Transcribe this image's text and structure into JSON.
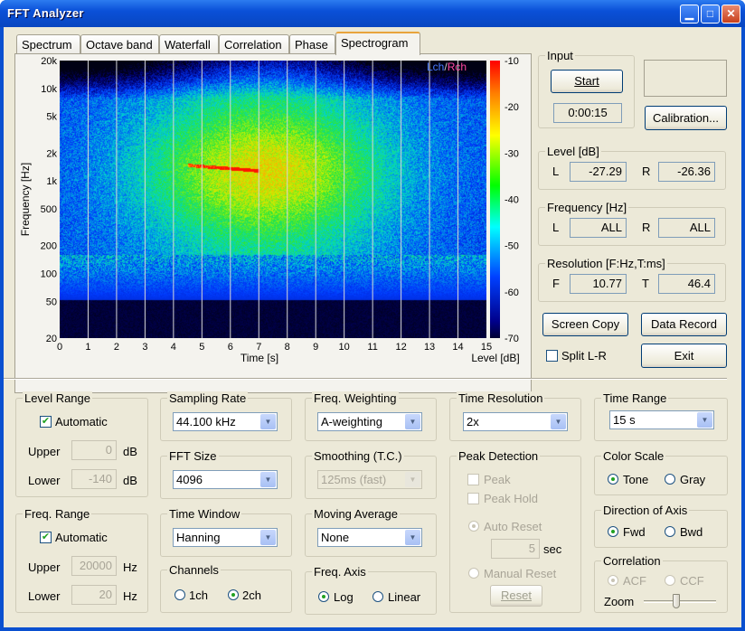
{
  "window": {
    "title": "FFT Analyzer"
  },
  "tabs": [
    "Spectrum",
    "Octave band",
    "Waterfall",
    "Correlation",
    "Phase",
    "Spectrogram"
  ],
  "chart_data": {
    "type": "heatmap",
    "title": "",
    "xlabel": "Time [s]",
    "ylabel": "Frequency [Hz]",
    "x_ticks": [
      "0",
      "1",
      "2",
      "3",
      "4",
      "5",
      "6",
      "7",
      "8",
      "9",
      "10",
      "11",
      "12",
      "13",
      "14",
      "15"
    ],
    "y_ticks": [
      "20k",
      "10k",
      "5k",
      "2k",
      "1k",
      "500",
      "200",
      "100",
      "50",
      "20"
    ],
    "xlim": [
      0,
      15
    ],
    "ylim": [
      20,
      20000
    ],
    "y_scale": "log",
    "colorbar_ticks": [
      "-10",
      "-20",
      "-30",
      "-40",
      "-50",
      "-60",
      "-70"
    ],
    "colorbar_label": "Level [dB]",
    "legend": [
      "Lch",
      "Rch"
    ],
    "legend_sep": "/"
  },
  "input": {
    "group": "Input",
    "start": "Start",
    "time": "0:00:15",
    "calibration": "Calibration..."
  },
  "level": {
    "group": "Level [dB]",
    "l_label": "L",
    "l_value": "-27.29",
    "r_label": "R",
    "r_value": "-26.36"
  },
  "frequency": {
    "group": "Frequency [Hz]",
    "l_label": "L",
    "l_value": "ALL",
    "r_label": "R",
    "r_value": "ALL"
  },
  "resolution": {
    "group": "Resolution [F:Hz,T:ms]",
    "f_label": "F",
    "f_value": "10.77",
    "t_label": "T",
    "t_value": "46.4"
  },
  "actions": {
    "screen_copy": "Screen Copy",
    "data_record": "Data Record",
    "split": "Split L-R",
    "exit": "Exit"
  },
  "level_range": {
    "group": "Level Range",
    "automatic": "Automatic",
    "upper_label": "Upper",
    "upper_value": "0",
    "lower_label": "Lower",
    "lower_value": "-140",
    "unit": "dB"
  },
  "freq_range": {
    "group": "Freq. Range",
    "automatic": "Automatic",
    "upper_label": "Upper",
    "upper_value": "20000",
    "lower_label": "Lower",
    "lower_value": "20",
    "unit": "Hz"
  },
  "sampling_rate": {
    "group": "Sampling Rate",
    "value": "44.100 kHz"
  },
  "fft_size": {
    "group": "FFT Size",
    "value": "4096"
  },
  "time_window": {
    "group": "Time Window",
    "value": "Hanning"
  },
  "channels": {
    "group": "Channels",
    "opt1": "1ch",
    "opt2": "2ch"
  },
  "freq_weighting": {
    "group": "Freq. Weighting",
    "value": "A-weighting"
  },
  "smoothing": {
    "group": "Smoothing (T.C.)",
    "value": "125ms (fast)"
  },
  "moving_average": {
    "group": "Moving Average",
    "value": "None"
  },
  "freq_axis": {
    "group": "Freq. Axis",
    "opt1": "Log",
    "opt2": "Linear"
  },
  "time_resolution": {
    "group": "Time Resolution",
    "value": "2x"
  },
  "peak_detection": {
    "group": "Peak Detection",
    "peak": "Peak",
    "peak_hold": "Peak Hold",
    "auto_reset": "Auto Reset",
    "seconds": "5",
    "sec": "sec",
    "manual_reset": "Manual Reset",
    "reset": "Reset"
  },
  "time_range": {
    "group": "Time Range",
    "value": "15 s"
  },
  "color_scale": {
    "group": "Color Scale",
    "opt1": "Tone",
    "opt2": "Gray"
  },
  "direction": {
    "group": "Direction of Axis",
    "opt1": "Fwd",
    "opt2": "Bwd"
  },
  "correlation": {
    "group": "Correlation",
    "opt1": "ACF",
    "opt2": "CCF",
    "zoom": "Zoom"
  },
  "colors": {
    "lch": "#4a7cff",
    "rch": "#ff4aa0"
  }
}
